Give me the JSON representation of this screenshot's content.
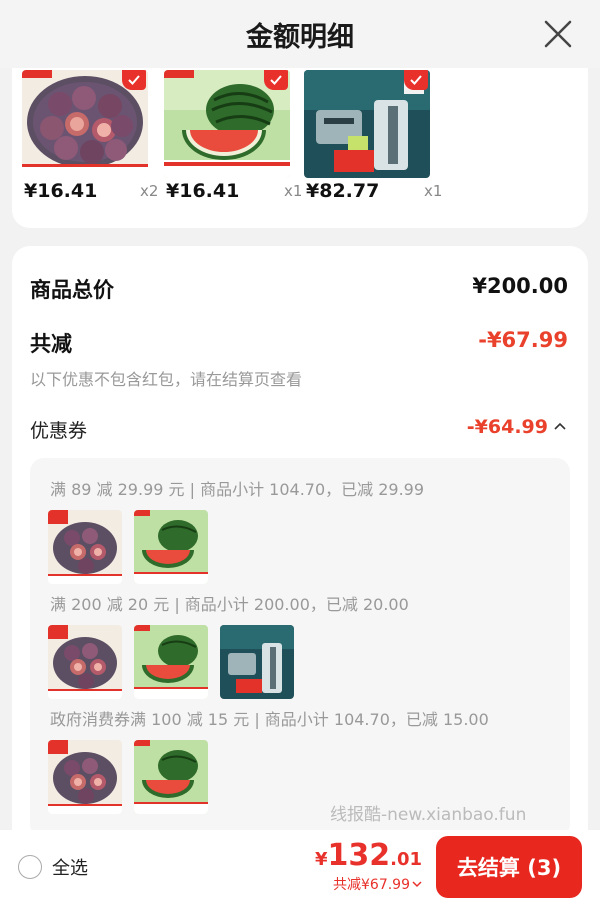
{
  "header": {
    "title": "金额明细"
  },
  "top_items": [
    {
      "name": "fig",
      "price": "¥16.41",
      "qty": "x2"
    },
    {
      "name": "watermelon",
      "price": "¥16.41",
      "qty": "x1"
    },
    {
      "name": "razor",
      "price": "¥82.77",
      "qty": "x1"
    }
  ],
  "summary": {
    "total_label": "商品总价",
    "total_value": "¥200.00",
    "reduce_label": "共减",
    "reduce_value": "-¥67.99",
    "note": "以下优惠不包含红包，请在结算页查看",
    "coupon_label": "优惠券",
    "coupon_value": "-¥64.99"
  },
  "coupon_groups": [
    {
      "text": "满 89 减 29.99 元 | 商品小计 104.70，已减 29.99"
    },
    {
      "text": "满 200 减 20 元 | 商品小计 200.00，已减 20.00"
    },
    {
      "text": "政府消费券满 100 减 15 元 | 商品小计 104.70，已减 15.00"
    }
  ],
  "watermark": "线报酷-new.xianbao.fun",
  "bottom": {
    "select_all": "全选",
    "price_currency": "¥",
    "price_int": "132",
    "price_dec": ".01",
    "saved": "共减¥67.99",
    "checkout": "去结算 (3)"
  },
  "colors": {
    "accent": "#e8271f",
    "discount": "#e9412b"
  }
}
